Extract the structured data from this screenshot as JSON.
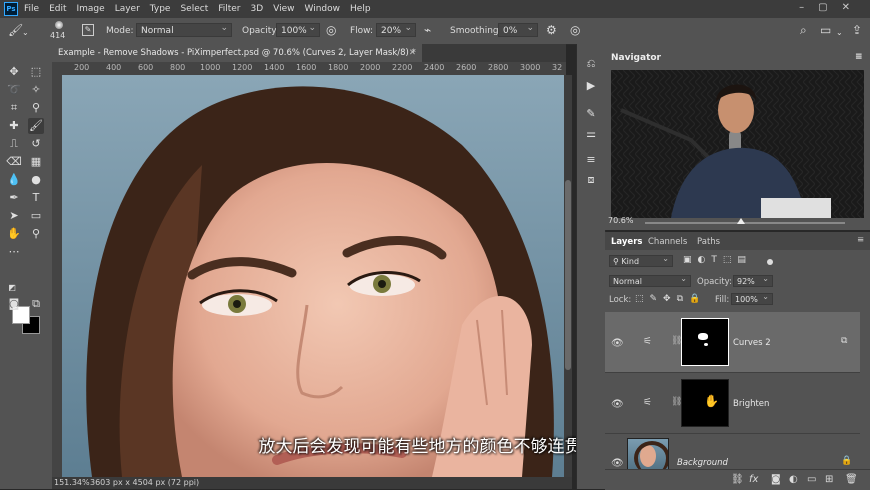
{
  "menu": {
    "app_icon": "Ps",
    "items": [
      "File",
      "Edit",
      "Image",
      "Layer",
      "Type",
      "Select",
      "Filter",
      "3D",
      "View",
      "Window",
      "Help"
    ]
  },
  "options": {
    "brush_size": "414",
    "mode_label": "Mode:",
    "mode_value": "Normal",
    "opacity_label": "Opacity:",
    "opacity_value": "100%",
    "flow_label": "Flow:",
    "flow_value": "20%",
    "smoothing_label": "Smoothing:",
    "smoothing_value": "0%"
  },
  "document": {
    "tab_title": "Example - Remove Shadows - PiXimperfect.psd @ 70.6% (Curves 2, Layer Mask/8) *",
    "ruler_ticks": [
      "200",
      "400",
      "600",
      "800",
      "1000",
      "1200",
      "1400",
      "1600",
      "1800",
      "2000",
      "2200",
      "2400",
      "2600",
      "2800",
      "3000",
      "32"
    ]
  },
  "status": {
    "zoom": "151.34%",
    "doc_info": "3603 px x 4504 px (72 ppi)"
  },
  "subtitle": "放大后会发现可能有些地方的颜色不够连贯",
  "navigator": {
    "title": "Navigator",
    "zoom": "70.6%"
  },
  "layers_panel": {
    "tabs": [
      "Layers",
      "Channels",
      "Paths"
    ],
    "filter_label": "Kind",
    "blend_mode": "Normal",
    "opacity_label": "Opacity:",
    "opacity_value": "92%",
    "lock_label": "Lock:",
    "fill_label": "Fill:",
    "fill_value": "100%",
    "layers": [
      {
        "name": "Curves 2",
        "selected": true
      },
      {
        "name": "Brighten",
        "selected": false
      },
      {
        "name": "Background",
        "selected": false
      }
    ],
    "bottom_icons": [
      "link-icon",
      "fx-icon",
      "mask-icon",
      "adjustment-icon",
      "group-icon",
      "new-layer-icon",
      "trash-icon"
    ]
  },
  "colors": {
    "panel_bg": "#535353",
    "dark_bg": "#282828",
    "selected_layer": "#6a6a6a",
    "ps_blue": "#31a8ff"
  }
}
